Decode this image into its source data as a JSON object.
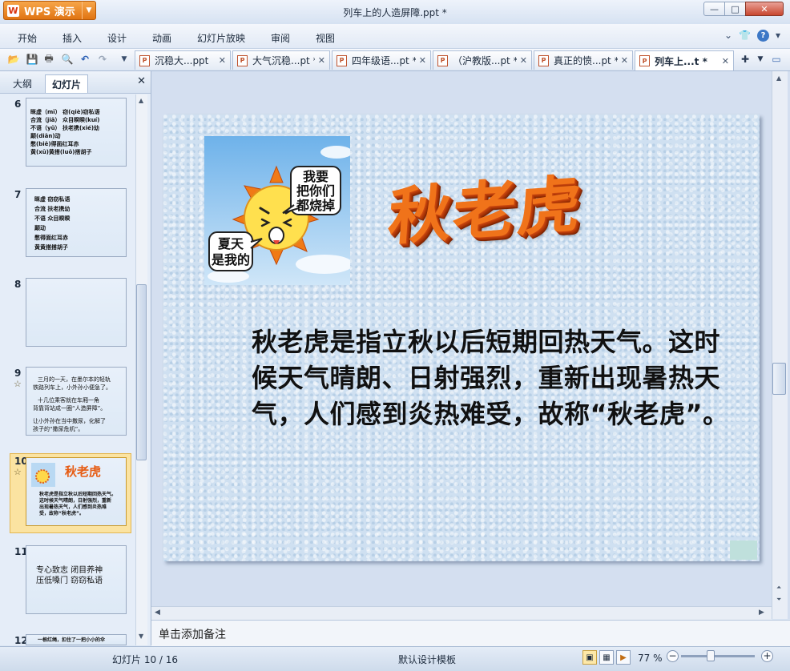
{
  "app": {
    "name": "WPS 演示",
    "logo_letter": "W",
    "window_title": "列车上的人造屏障.ppt *"
  },
  "window_controls": {
    "minimize": "—",
    "maximize": "□",
    "close": "✕"
  },
  "menu": [
    "开始",
    "插入",
    "设计",
    "动画",
    "幻灯片放映",
    "审阅",
    "视图"
  ],
  "toolbar_icons": [
    "open-icon",
    "save-icon",
    "print-icon",
    "print-preview-icon",
    "undo-icon",
    "redo-icon"
  ],
  "doc_tabs": [
    {
      "label": "沉稳大...ppt",
      "active": false
    },
    {
      "label": "大气沉稳...pt *",
      "active": false
    },
    {
      "label": "四年级语...pt *",
      "active": false
    },
    {
      "label": "（沪教版...pt *",
      "active": false
    },
    {
      "label": "真正的愤...pt *",
      "active": false
    },
    {
      "label": "列车上...t *",
      "active": true
    }
  ],
  "tab_file_icon_letter": "P",
  "panel": {
    "tabs": [
      "大纲",
      "幻灯片"
    ],
    "active_tab": "幻灯片",
    "close": "✕"
  },
  "thumbnails": [
    {
      "number": "6",
      "lines": [
        "眯虚（mī）  窃(qiè)窃私语",
        "合流（jiā）  众目睽睽(kuí)",
        "不语（yǔ）   扶老携(xié)幼",
        "颠(diān)动",
        "憋(biē)得面红耳赤",
        "黄(xū)黄搭(luō)搭胡子"
      ]
    },
    {
      "number": "7",
      "lines": [
        "眯虚        窃窃私语",
        "合流        扶老携幼",
        "不语        众目睽睽",
        "颠动",
        "憋得面红耳赤",
        "黄黄搭搭胡子"
      ]
    },
    {
      "number": "8",
      "lines": []
    },
    {
      "number": "9",
      "lines": [
        "三月的一天，在墨尔本的轻轨",
        "铁路列车上，小外孙小便急了。",
        "十几位乘客就在车厢一角",
        "背靠背站成一圈“人造屏障”。",
        "让小外孙在当中撒尿，化解了",
        "孩子的“撒尿危机”。"
      ]
    },
    {
      "number": "10",
      "title": "秋老虎",
      "lines": [
        "秋老虎是指立秋以后短期回热天气。",
        "这时候天气晴朗，日射强烈，重新",
        "出现暑热天气，人们感到炎热难",
        "受，故称“秋老虎”。"
      ]
    },
    {
      "number": "11",
      "lines": [
        "专心致志    闭目养神",
        "压低嗓门    窃窃私语"
      ]
    },
    {
      "number": "12",
      "lines": [
        "一根红绳，扣住了一把小小的伞"
      ]
    }
  ],
  "slide": {
    "title": "秋老虎",
    "body": "秋老虎是指立秋以后短期回热天气。这时候天气晴朗、日射强烈，重新出现暑热天气，人们感到炎热难受，故称“秋老虎”。",
    "bubble_top": [
      "我要",
      "把你们",
      "都烧掉"
    ],
    "bubble_bottom": [
      "夏天",
      "是我的"
    ]
  },
  "notes_placeholder": "单击添加备注",
  "status": {
    "slide": "幻灯片 10 / 16",
    "template": "默认设计模板",
    "zoom": "77 %"
  }
}
